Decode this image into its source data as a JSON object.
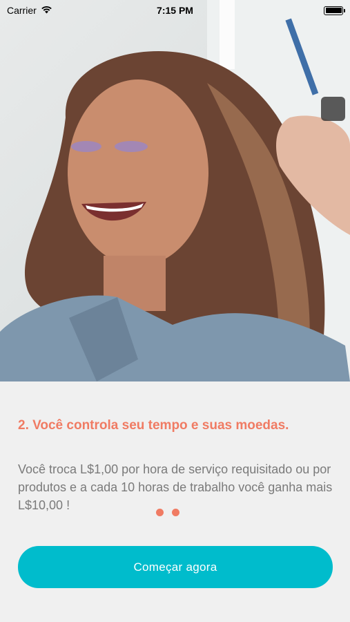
{
  "status_bar": {
    "carrier": "Carrier",
    "time": "7:15 PM"
  },
  "hero": {
    "image_icon": "photo-woman-hair-styling"
  },
  "onboarding": {
    "heading": "2. Você controla seu tempo e suas moedas.",
    "body": "Você troca L$1,00 por hora de serviço requisitado ou por produtos e a cada 10 horas de trabalho você ganha mais L$10,00 !",
    "page_dots": 2,
    "cta_label": "Começar agora"
  },
  "colors": {
    "accent": "#f07b63",
    "button": "#00bccc",
    "body_text": "#7a7a7a",
    "background": "#f0f0f0"
  }
}
